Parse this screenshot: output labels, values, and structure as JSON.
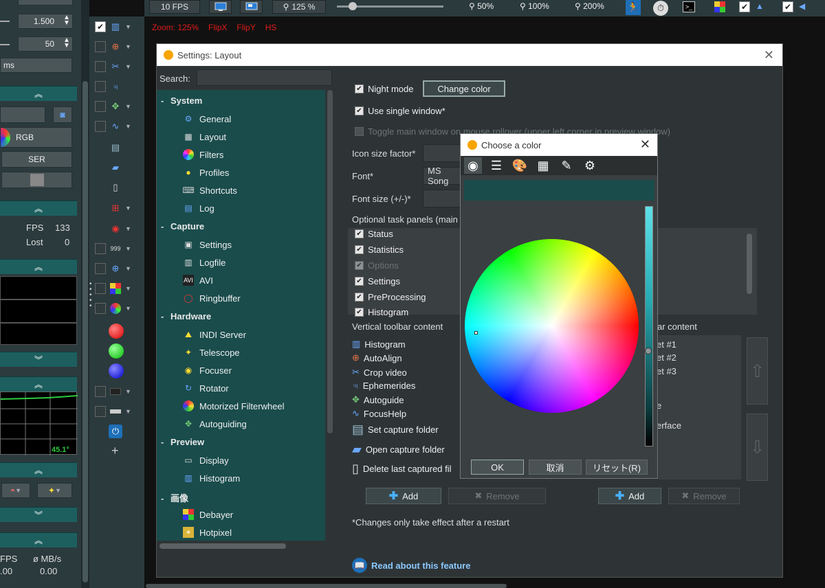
{
  "topbar": {
    "fps_button": "10 FPS",
    "zoom_button": "125 %",
    "zoom_presets": [
      "50%",
      "100%",
      "200%"
    ],
    "slider_level": 0.15,
    "zoom_line": [
      "Zoom: 125%",
      "FlipX",
      "FlipY",
      "HS"
    ]
  },
  "left_panel": {
    "gain_value": "1.500",
    "offset_value": "50",
    "exposure_unit": "ms",
    "rgb_button": "RGB",
    "ser_button": "SER",
    "fps_label": "FPS",
    "fps_value": "133",
    "lost_label": "Lost",
    "lost_value": "0",
    "temperature": "45.1°",
    "bottom_fps_label": "FPS",
    "bottom_rate_label": "ø MB/s",
    "bottom_fps_value": ".00",
    "bottom_rate_value": "0.00"
  },
  "settings_dialog": {
    "title": "Settings: Layout",
    "search_label": "Search:",
    "tree": [
      {
        "group": "System",
        "items": [
          "General",
          "Layout",
          "Filters",
          "Profiles",
          "Shortcuts",
          "Log"
        ]
      },
      {
        "group": "Capture",
        "items": [
          "Settings",
          "Logfile",
          "AVI",
          "Ringbuffer"
        ]
      },
      {
        "group": "Hardware",
        "items": [
          "INDI Server",
          "Telescope",
          "Focuser",
          "Rotator",
          "Motorized Filterwheel",
          "Autoguiding"
        ]
      },
      {
        "group": "Preview",
        "items": [
          "Display",
          "Histogram"
        ]
      },
      {
        "group": "画像",
        "items": [
          "Debayer",
          "Hotpixel"
        ]
      }
    ],
    "night_mode": "Night mode",
    "change_color": "Change color",
    "single_window": "Use single window*",
    "toggle_main": "Toggle main window on mouse rollover (upper left corner in preview window)",
    "icon_size_label": "Icon size factor*",
    "font_label": "Font*",
    "font_value": "MS Song",
    "font_size_label": "Font size (+/-)*",
    "task_panels_label": "Optional task panels (main w",
    "task_panels": [
      {
        "label": "Status",
        "enabled": true
      },
      {
        "label": "Statistics",
        "enabled": true
      },
      {
        "label": "Options",
        "enabled": false
      },
      {
        "label": "Settings",
        "enabled": true
      },
      {
        "label": "PreProcessing",
        "enabled": true
      },
      {
        "label": "Histogram",
        "enabled": true
      }
    ],
    "vertical_label": "Vertical toolbar content",
    "horizontal_label": "ar content",
    "vertical_items": [
      "Histogram",
      "AutoAlign",
      "Crop video",
      "Ephemerides",
      "Autoguide",
      "FocusHelp",
      "Set capture folder",
      "Open capture folder",
      "Delete last captured fil"
    ],
    "horizontal_items": [
      "et #1",
      "et #2",
      "et #3",
      "e",
      "erface"
    ],
    "add": "Add",
    "remove": "Remove",
    "note": "*Changes only take effect after a restart",
    "read_about": "Read about this feature"
  },
  "color_dialog": {
    "title": "Choose a color",
    "selected_color": "#1a4c4c",
    "ok": "OK",
    "cancel": "取消",
    "reset": "リセット(R)"
  }
}
